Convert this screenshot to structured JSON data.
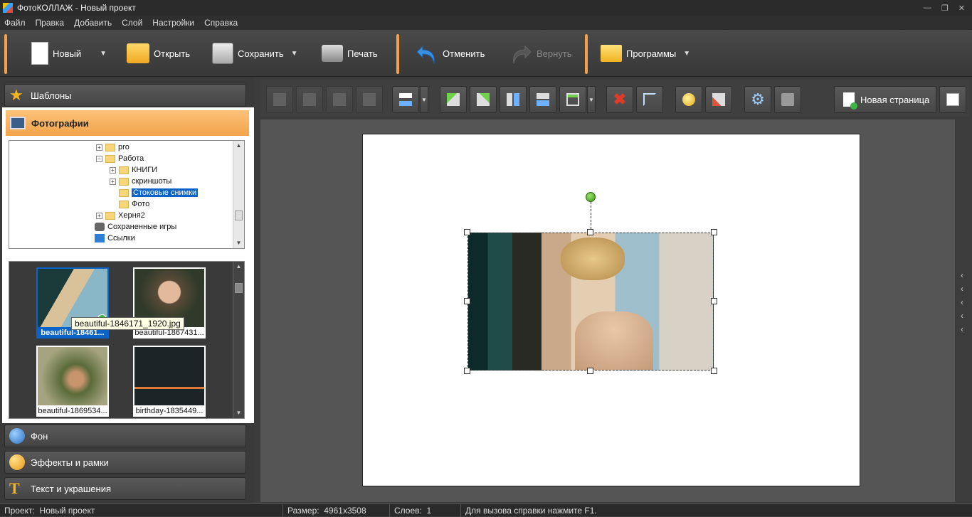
{
  "window": {
    "title": "ФотоКОЛЛАЖ - Новый проект"
  },
  "menu": [
    "Файл",
    "Правка",
    "Добавить",
    "Слой",
    "Настройки",
    "Справка"
  ],
  "toolbar": {
    "new_label": "Новый",
    "open_label": "Открыть",
    "save_label": "Сохранить",
    "print_label": "Печать",
    "undo_label": "Отменить",
    "redo_label": "Вернуть",
    "programs_label": "Программы"
  },
  "sidebar": {
    "templates": "Шаблоны",
    "photos": "Фотографии",
    "background": "Фон",
    "effects": "Эффекты и рамки",
    "text": "Текст и украшения"
  },
  "tree": [
    {
      "label": "pro",
      "expander": "+",
      "selected": false
    },
    {
      "label": "Работа",
      "expander": "−",
      "selected": false
    },
    {
      "label": "КНИГИ",
      "expander": "+",
      "selected": false
    },
    {
      "label": "скриншоты",
      "expander": "+",
      "selected": false
    },
    {
      "label": "Стоковые снимки",
      "expander": "",
      "selected": true
    },
    {
      "label": "Фото",
      "expander": "",
      "selected": false
    },
    {
      "label": "Херня2",
      "expander": "+",
      "selected": false
    },
    {
      "label": "Сохраненные игры",
      "expander": "",
      "selected": false
    },
    {
      "label": "Ссылки",
      "expander": "",
      "selected": false
    }
  ],
  "thumbnails": [
    {
      "label": "beautiful-18461...",
      "selected": true
    },
    {
      "label": "beautiful-1867431...",
      "selected": false
    },
    {
      "label": "beautiful-1869534...",
      "selected": false
    },
    {
      "label": "birthday-1835449...",
      "selected": false
    }
  ],
  "tooltip": "beautiful-1846171_1920.jpg",
  "edit_toolbar": {
    "new_page": "Новая страница"
  },
  "status": {
    "project_label": "Проект:",
    "project_value": "Новый проект",
    "size_label": "Размер:",
    "size_value": "4961x3508",
    "layers_label": "Слоев:",
    "layers_value": "1",
    "help_text": "Для вызова справки нажмите F1."
  },
  "colors": {
    "accent": "#f2a34a",
    "selection": "#0a64c8",
    "panel": "#3a3a3a"
  }
}
